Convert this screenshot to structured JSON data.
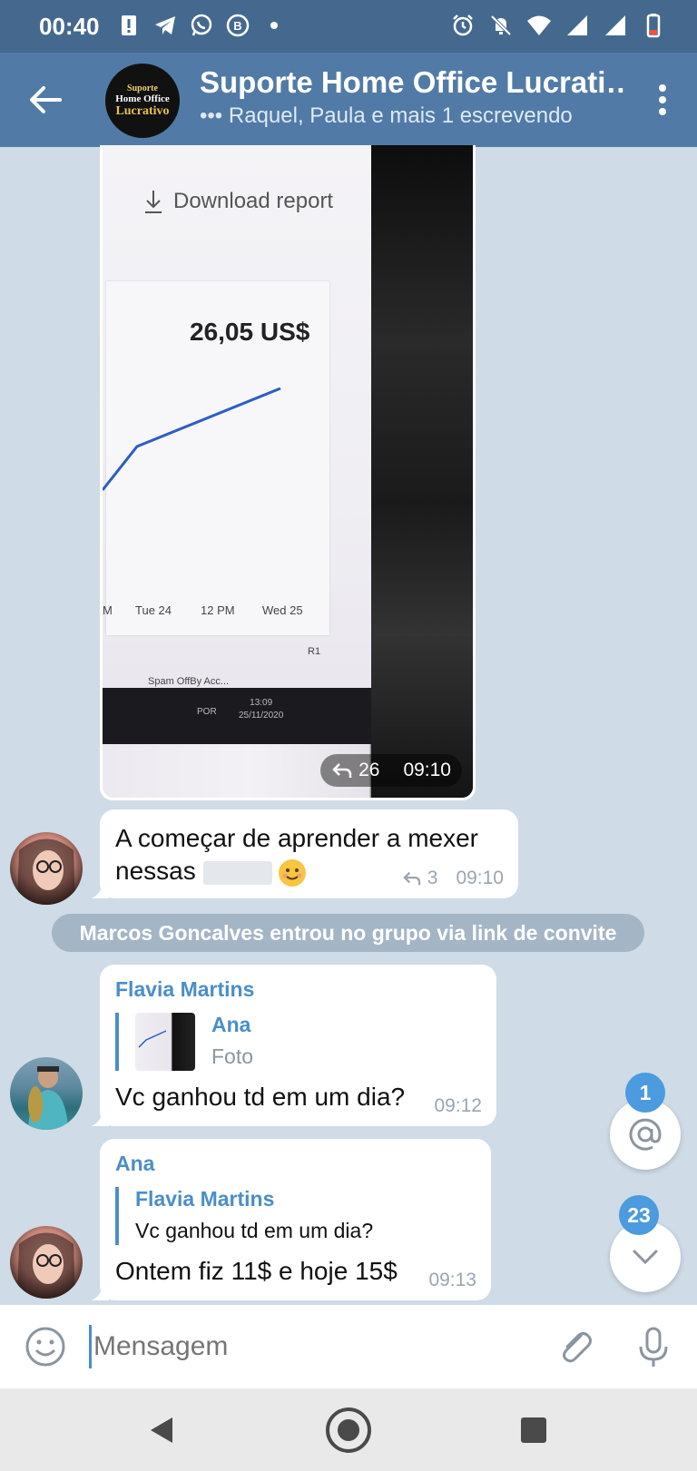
{
  "status_bar": {
    "time": "00:40",
    "left_icons": [
      "alert-icon",
      "telegram-icon",
      "whatsapp-icon",
      "b-app-icon",
      "dot-icon"
    ],
    "right_icons": [
      "alarm-icon",
      "mute-icon",
      "wifi-icon",
      "signal-icon",
      "signal-icon",
      "battery-icon"
    ]
  },
  "header": {
    "title": "Suporte Home Office Lucrati…",
    "subtitle": "Raquel, Paula e mais 1 escrevendo",
    "avatar_lines": [
      "Suporte",
      "Home Office",
      "Lucrativo"
    ]
  },
  "photo_message": {
    "photo_texts": {
      "download": "Download report",
      "amount": "26,05 US$",
      "axis_labels": [
        "M",
        "Tue 24",
        "12 PM",
        "Wed 25"
      ],
      "bottom_label": "Spam OffBy Acc...",
      "r1": "R1",
      "clock_time": "13:09",
      "clock_date": "25/11/2020",
      "lang": "POR"
    },
    "forwards": "26",
    "time": "09:10"
  },
  "message_1": {
    "text_before": "A começar de aprender a mexer nessas",
    "forwards": "3",
    "time": "09:10"
  },
  "service_message": "Marcos Goncalves entrou no grupo via link de convite",
  "message_2": {
    "sender": "Flavia Martins",
    "reply_name": "Ana",
    "reply_text": "Foto",
    "text": "Vc ganhou td em um dia?",
    "time": "09:12"
  },
  "message_3": {
    "sender": "Ana",
    "reply_name": "Flavia Martins",
    "reply_text": "Vc ganhou td em um dia?",
    "text": "Ontem fiz 11$ e hoje 15$",
    "time": "09:13"
  },
  "fab": {
    "mentions_badge": "1",
    "unread_badge": "23"
  },
  "input": {
    "placeholder": "Mensagem"
  },
  "colors": {
    "header": "#517ba6",
    "status_bar": "#45698e",
    "accent": "#4a8ec9",
    "badge": "#4b9bde",
    "chat_bg": "#cfdbe6"
  }
}
